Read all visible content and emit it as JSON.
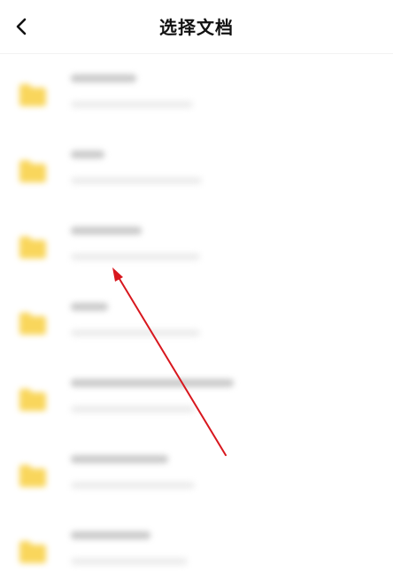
{
  "header": {
    "title": "选择文档",
    "back_icon": "chevron-left-icon"
  },
  "folder_icon": "folder-icon",
  "colors": {
    "folder": "#F9D65C",
    "annotation_arrow": "#D8171E"
  },
  "items": [
    {
      "name": "",
      "meta": ""
    },
    {
      "name": "",
      "meta": ""
    },
    {
      "name": "",
      "meta": ""
    },
    {
      "name": "",
      "meta": ""
    },
    {
      "name": "",
      "meta": ""
    },
    {
      "name": "",
      "meta": ""
    },
    {
      "name": "",
      "meta": ""
    }
  ]
}
